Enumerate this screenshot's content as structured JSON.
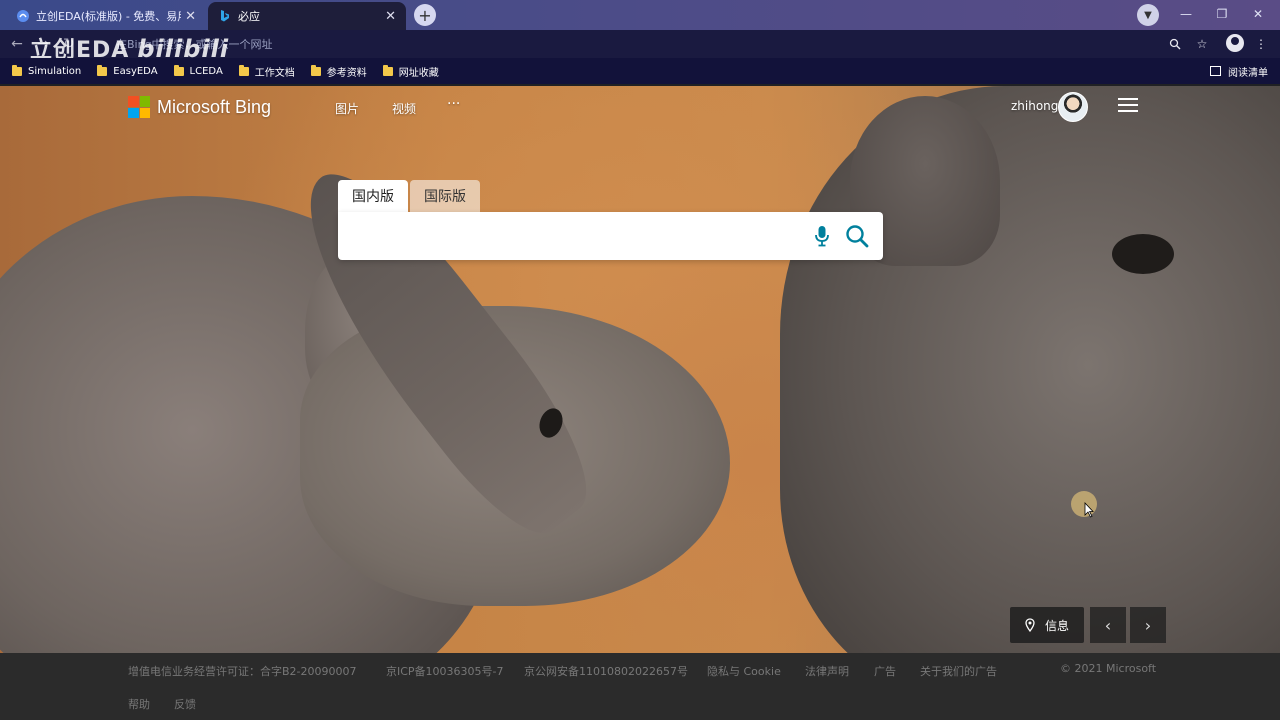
{
  "browser": {
    "tabs": [
      {
        "title": "立创EDA(标准版) - 免费、易用、",
        "icon": "easyeda-icon",
        "active": false
      },
      {
        "title": "必应",
        "icon": "bing-b-icon",
        "active": true
      }
    ],
    "omnibox_placeholder": "在Bing中搜索，或输入一个网址",
    "bookmarks": [
      "Simulation",
      "EasyEDA",
      "LCEDA",
      "工作文档",
      "参考资料",
      "网址收藏"
    ],
    "reading_list": "阅读清单"
  },
  "watermark": {
    "text": "立创EDA",
    "bili": "bilibili"
  },
  "bing": {
    "brand": "Microsoft Bing",
    "nav": [
      "图片",
      "视频",
      "···"
    ],
    "user": "zhihong",
    "search_tabs": [
      "国内版",
      "国际版"
    ],
    "search_value": "",
    "info_label": "信息"
  },
  "footer": {
    "row1": [
      "增值电信业务经营许可证：合字B2-20090007",
      "京ICP备10036305号-7",
      "京公网安备11010802022657号",
      "隐私与 Cookie",
      "法律声明",
      "广告",
      "关于我们的广告"
    ],
    "copyright": "© 2021 Microsoft",
    "row2": [
      "帮助",
      "反馈"
    ]
  },
  "colors": {
    "ms_red": "#f25022",
    "ms_green": "#7fba00",
    "ms_blue": "#00a4ef",
    "ms_yellow": "#ffb900",
    "search_accent": "#00809d"
  }
}
